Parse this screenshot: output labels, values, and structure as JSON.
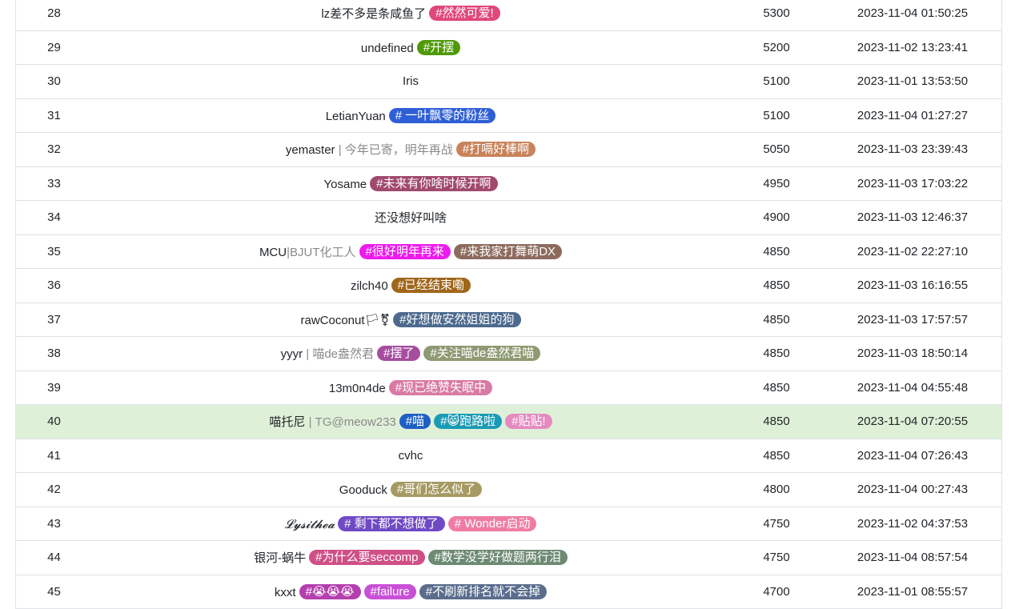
{
  "rows": [
    {
      "rank": "28",
      "name": "lz差不多是条咸鱼了",
      "subtitle": "",
      "tags": [
        {
          "text": "#然然可爱!",
          "color": "#e0477a"
        }
      ],
      "score": "5300",
      "time": "2023-11-04 01:50:25",
      "highlight": false
    },
    {
      "rank": "29",
      "name": "undefined",
      "subtitle": "",
      "tags": [
        {
          "text": "#开摆",
          "color": "#4e9a06"
        }
      ],
      "score": "5200",
      "time": "2023-11-02 13:23:41",
      "highlight": false
    },
    {
      "rank": "30",
      "name": "Iris",
      "subtitle": "",
      "tags": [],
      "score": "5100",
      "time": "2023-11-01 13:53:50",
      "highlight": false
    },
    {
      "rank": "31",
      "name": "LetianYuan",
      "subtitle": "",
      "tags": [
        {
          "text": "# 一叶飘零的粉丝",
          "color": "#2f5fd6"
        }
      ],
      "score": "5100",
      "time": "2023-11-04 01:27:27",
      "highlight": false
    },
    {
      "rank": "32",
      "name": "yemaster",
      "subtitle": " | 今年已寄，明年再战",
      "tags": [
        {
          "text": "#打嗝好棒啊",
          "color": "#c8835a"
        }
      ],
      "score": "5050",
      "time": "2023-11-03 23:39:43",
      "highlight": false
    },
    {
      "rank": "33",
      "name": "Yosame",
      "subtitle": "",
      "tags": [
        {
          "text": "#未来有你啥时候开啊",
          "color": "#a0496e"
        }
      ],
      "score": "4950",
      "time": "2023-11-03 17:03:22",
      "highlight": false
    },
    {
      "rank": "34",
      "name": "还没想好叫啥",
      "subtitle": "",
      "tags": [],
      "score": "4900",
      "time": "2023-11-03 12:46:37",
      "highlight": false
    },
    {
      "rank": "35",
      "name": "MCU",
      "subtitle": "|BJUT化工人",
      "tags": [
        {
          "text": "#很好明年再来",
          "color": "#ee1aee"
        },
        {
          "text": "#来我家打舞萌DX",
          "color": "#8c6b5d"
        }
      ],
      "score": "4850",
      "time": "2023-11-02 22:27:10",
      "highlight": false
    },
    {
      "rank": "36",
      "name": "zilch40",
      "subtitle": "",
      "tags": [
        {
          "text": "#已经结束嘞",
          "color": "#a0661a"
        }
      ],
      "score": "4850",
      "time": "2023-11-03 16:16:55",
      "highlight": false
    },
    {
      "rank": "37",
      "name": "rawCoconut🏳⚧",
      "subtitle": "",
      "tags": [
        {
          "text": "#好想做安然姐姐的狗",
          "color": "#4d6a8e"
        }
      ],
      "score": "4850",
      "time": "2023-11-03 17:57:57",
      "highlight": false
    },
    {
      "rank": "38",
      "name": "yyyr",
      "subtitle": " | 喵de盎然君",
      "tags": [
        {
          "text": "#摆了",
          "color": "#a64da0"
        },
        {
          "text": "#关注喵de盎然君喵",
          "color": "#8e9a73"
        }
      ],
      "score": "4850",
      "time": "2023-11-03 18:50:14",
      "highlight": false
    },
    {
      "rank": "39",
      "name": "13m0n4de",
      "subtitle": "",
      "tags": [
        {
          "text": "#现已绝赞失眠中",
          "color": "#d97aa4"
        }
      ],
      "score": "4850",
      "time": "2023-11-04 04:55:48",
      "highlight": false
    },
    {
      "rank": "40",
      "name": "喵托尼",
      "subtitle": " | TG@meow233",
      "tags": [
        {
          "text": "#喵",
          "color": "#1f5fc4"
        },
        {
          "text": "#😸跑路啦",
          "color": "#1a9bb5"
        },
        {
          "text": "#贴贴!",
          "color": "#e58ac0"
        }
      ],
      "score": "4850",
      "time": "2023-11-04 07:20:55",
      "highlight": true
    },
    {
      "rank": "41",
      "name": "cvhc",
      "subtitle": "",
      "tags": [],
      "score": "4850",
      "time": "2023-11-04 07:26:43",
      "highlight": false
    },
    {
      "rank": "42",
      "name": "Gooduck",
      "subtitle": "",
      "tags": [
        {
          "text": "#哥们怎么似了",
          "color": "#a69a62"
        }
      ],
      "score": "4800",
      "time": "2023-11-04 00:27:43",
      "highlight": false
    },
    {
      "rank": "43",
      "name": "𝓛𝔂𝓼𝓲𝓽𝓱𝓮𝓪",
      "subtitle": "",
      "tags": [
        {
          "text": "# 剩下都不想做了",
          "color": "#6f4ac4"
        },
        {
          "text": "# Wonder启动",
          "color": "#f07ca5"
        }
      ],
      "score": "4750",
      "time": "2023-11-02 04:37:53",
      "highlight": false
    },
    {
      "rank": "44",
      "name": "银河-蜗牛",
      "subtitle": "",
      "tags": [
        {
          "text": "#为什么要seccomp",
          "color": "#cf4f86"
        },
        {
          "text": "#数学没学好做题两行泪",
          "color": "#6d8a73"
        }
      ],
      "score": "4750",
      "time": "2023-11-04 08:57:54",
      "highlight": false
    },
    {
      "rank": "45",
      "name": "kxxt",
      "subtitle": "",
      "tags": [
        {
          "text": "#😭😭😭",
          "color": "#b43fae"
        },
        {
          "text": "#failure",
          "color": "#c84fd6"
        },
        {
          "text": "#不刷新排名就不会掉",
          "color": "#5a6d8c"
        }
      ],
      "score": "4700",
      "time": "2023-11-01 08:55:57",
      "highlight": false
    }
  ]
}
